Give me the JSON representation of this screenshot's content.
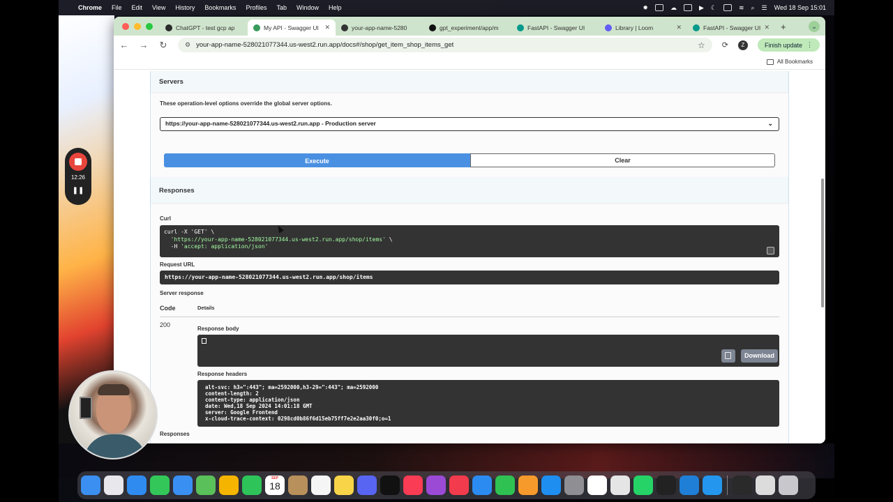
{
  "menubar": {
    "app": "Chrome",
    "items": [
      "File",
      "Edit",
      "View",
      "History",
      "Bookmarks",
      "Profiles",
      "Tab",
      "Window",
      "Help"
    ],
    "clock": "Wed 18 Sep  15:01"
  },
  "browser": {
    "tabs": [
      {
        "label": "ChatGPT - test gcp ap",
        "color": "#2b2b2b",
        "active": false
      },
      {
        "label": "My API - Swagger UI",
        "color": "#3a9a5c",
        "active": true
      },
      {
        "label": "your-app-name-5280",
        "color": "#333333",
        "active": false
      },
      {
        "label": "gpt_experiment/app/m",
        "color": "#111111",
        "active": false
      },
      {
        "label": "FastAPI - Swagger UI",
        "color": "#05998b",
        "active": false
      },
      {
        "label": "Library | Loom",
        "color": "#625df5",
        "active": false
      },
      {
        "label": "FastAPI - Swagger UI",
        "color": "#05998b",
        "active": false
      }
    ],
    "url": "your-app-name-528021077344.us-west2.run.app/docs#/shop/get_item_shop_items_get",
    "finish_update": "Finish update",
    "profile_initial": "Z",
    "bookmarks_label": "All Bookmarks"
  },
  "swagger": {
    "servers_title": "Servers",
    "servers_note": "These operation-level options override the global server options.",
    "server_selected": "https://your-app-name-528021077344.us-west2.run.app - Production server",
    "execute_label": "Execute",
    "clear_label": "Clear",
    "responses_title": "Responses",
    "curl_label": "Curl",
    "curl_cmd": "curl -X 'GET' \\",
    "curl_url": "'https://your-app-name-528021077344.us-west2.run.app/shop/items'",
    "curl_header_flag": "-H ",
    "curl_header": "'accept: application/json'",
    "request_url_label": "Request URL",
    "request_url": "https://your-app-name-528021077344.us-west2.run.app/shop/items",
    "server_response_label": "Server response",
    "code_header": "Code",
    "details_header": "Details",
    "status_code": "200",
    "response_body_label": "Response body",
    "download_label": "Download",
    "response_headers_label": "Response headers",
    "response_headers": [
      "alt-svc: h3=\":443\"; ma=2592000,h3-29=\":443\"; ma=2592000",
      "content-length: 2",
      "content-type: application/json",
      "date: Wed,18 Sep 2024 14:01:18 GMT",
      "server: Google Frontend",
      "x-cloud-trace-context: 0298cd0b86f6d15eb75ff7e2e2aa30f0;o=1"
    ],
    "responses_footer": "Responses"
  },
  "recorder": {
    "elapsed": "12:26"
  },
  "dock": {
    "calendar_month": "SEP",
    "calendar_day": "18",
    "icons": [
      {
        "name": "finder-icon",
        "color": "#3b8ff0"
      },
      {
        "name": "launchpad-icon",
        "color": "#e8e8ec"
      },
      {
        "name": "safari-icon",
        "color": "#2f8bf0"
      },
      {
        "name": "messages-icon",
        "color": "#33c759"
      },
      {
        "name": "mail-icon",
        "color": "#3a8ff2"
      },
      {
        "name": "maps-icon",
        "color": "#5ac05a"
      },
      {
        "name": "photos-icon",
        "color": "#f4b400"
      },
      {
        "name": "facetime-icon",
        "color": "#2ec45a"
      },
      {
        "name": "calendar-icon",
        "color": "#ffffff"
      },
      {
        "name": "contacts-icon",
        "color": "#b8905c"
      },
      {
        "name": "reminders-icon",
        "color": "#f5f5f5"
      },
      {
        "name": "notes-icon",
        "color": "#f8d448"
      },
      {
        "name": "discord-icon",
        "color": "#5865f2"
      },
      {
        "name": "appletv-icon",
        "color": "#111111"
      },
      {
        "name": "music-icon",
        "color": "#fa3c54"
      },
      {
        "name": "podcasts-icon",
        "color": "#9b4ad6"
      },
      {
        "name": "news-icon",
        "color": "#f23b4c"
      },
      {
        "name": "keynote-icon",
        "color": "#2c8bf0"
      },
      {
        "name": "numbers-icon",
        "color": "#2fc152"
      },
      {
        "name": "pages-icon",
        "color": "#f79a2c"
      },
      {
        "name": "appstore-icon",
        "color": "#1f8ef1"
      },
      {
        "name": "settings-icon",
        "color": "#8e8e93"
      },
      {
        "name": "notion-icon",
        "color": "#ffffff"
      },
      {
        "name": "chrome-icon",
        "color": "#e5e5e5"
      },
      {
        "name": "whatsapp-icon",
        "color": "#25d366"
      },
      {
        "name": "terminal-icon",
        "color": "#222222"
      },
      {
        "name": "vscode-icon",
        "color": "#1f7fd6"
      },
      {
        "name": "docker-icon",
        "color": "#2496ed"
      },
      {
        "name": "screen-thumbnail-icon",
        "color": "#2a2a2a"
      },
      {
        "name": "window-thumbnail-icon",
        "color": "#dcdcdc"
      },
      {
        "name": "trash-icon",
        "color": "#c8c8cc"
      }
    ]
  }
}
